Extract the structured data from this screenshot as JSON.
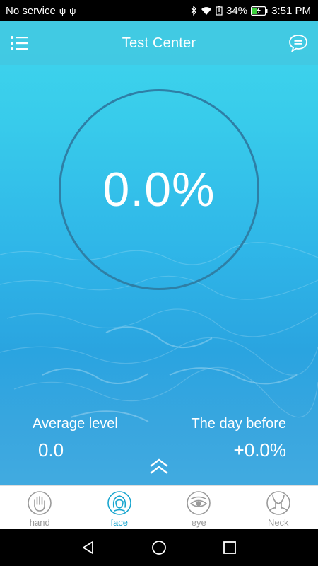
{
  "status_bar": {
    "carrier": "No service",
    "battery_percent": "34%",
    "time": "3:51 PM",
    "icons": [
      "usb-icon",
      "usb-icon",
      "bluetooth-icon",
      "wifi-icon",
      "battery-alert-icon",
      "battery-charging-icon"
    ]
  },
  "header": {
    "title": "Test Center",
    "menu_icon": "list-menu-icon",
    "chat_icon": "chat-bubble-icon"
  },
  "gauge": {
    "value": "0.0%"
  },
  "stats": {
    "average_label": "Average level",
    "average_value": "0.0",
    "day_before_label": "The day before",
    "day_before_value": "+0.0%"
  },
  "expand_icon": "double-chevron-up-icon",
  "tabs": [
    {
      "label": "hand",
      "icon": "hand-icon",
      "active": false
    },
    {
      "label": "face",
      "icon": "face-icon",
      "active": true
    },
    {
      "label": "eye",
      "icon": "eye-icon",
      "active": false
    },
    {
      "label": "Neck",
      "icon": "neck-icon",
      "active": false
    }
  ],
  "colors": {
    "accent": "#1aa6cf",
    "inactive": "#9a9a9a",
    "gauge_ring": "#2e7fa6"
  }
}
